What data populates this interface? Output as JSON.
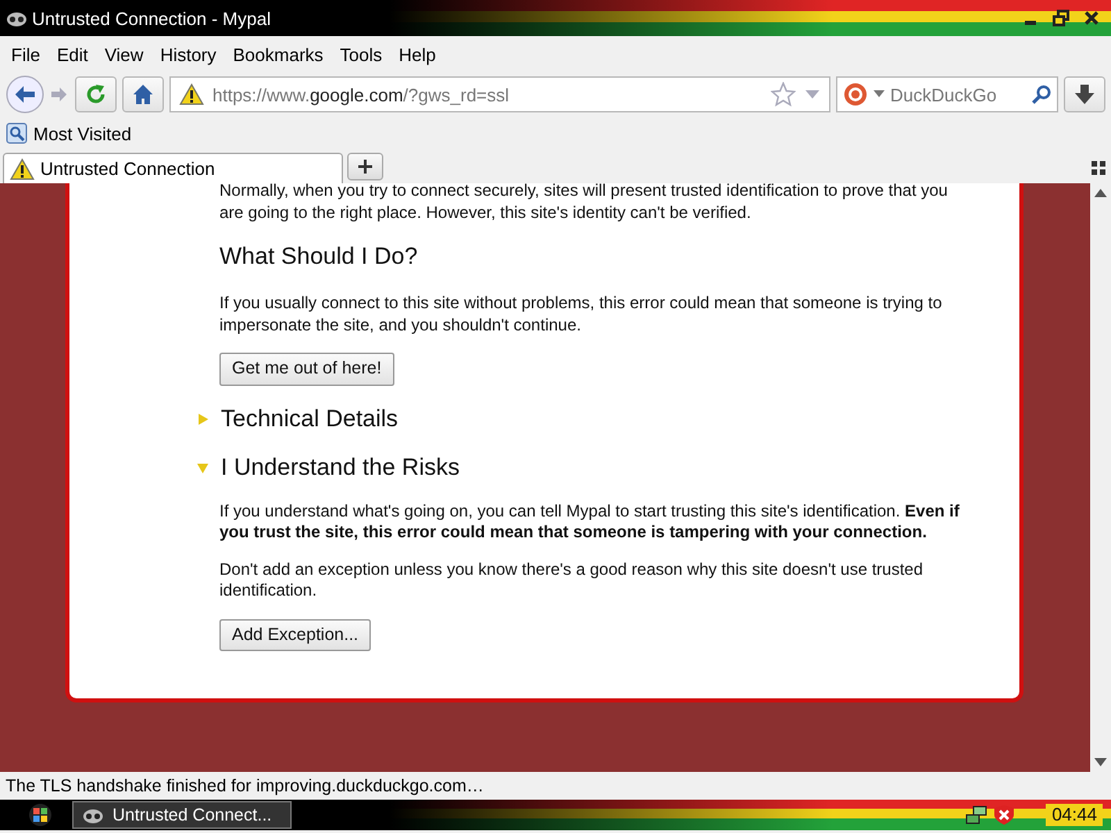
{
  "window": {
    "title": "Untrusted Connection - Mypal"
  },
  "menu": [
    {
      "label": "File"
    },
    {
      "label": "Edit"
    },
    {
      "label": "View"
    },
    {
      "label": "History"
    },
    {
      "label": "Bookmarks"
    },
    {
      "label": "Tools"
    },
    {
      "label": "Help"
    }
  ],
  "toolbar": {
    "url": "https://www.**google.com**/?gws_rd=ssl",
    "search": {
      "placeholder": "DuckDuckGo"
    }
  },
  "bookmarks": [
    {
      "label": "Most Visited"
    }
  ],
  "tabs": [
    {
      "label": "Untrusted Connection",
      "selected": true
    }
  ],
  "page": {
    "intro": "Normally, when you try to connect securely, sites will present trusted identification to prove that you are going to the right place. However, this site's identity can't be verified.",
    "heading": "What Should I Do?",
    "advice": "If you usually connect to this site without problems, this error could mean that someone is trying to impersonate the site, and you shouldn't continue.",
    "escape_button": "Get me out of here!",
    "sections": [
      {
        "title": "Technical Details",
        "expanded": false
      },
      {
        "title": "I Understand the Risks",
        "expanded": true,
        "paragraphs": [
          "If you understand what's going on, you can tell Mypal to start trusting this site's identification. **Even if you trust the site, this error could mean that someone is tampering with your connection.**",
          "Don't add an exception unless you know there's a good reason why this site doesn't use trusted identification."
        ],
        "button": "Add Exception..."
      }
    ]
  },
  "status_bar": "The TLS handshake finished for improving.duckduckgo.com…",
  "taskbar": {
    "tasks": [
      {
        "label": "Untrusted Connect...",
        "selected": true
      }
    ],
    "clock": "04:44"
  }
}
